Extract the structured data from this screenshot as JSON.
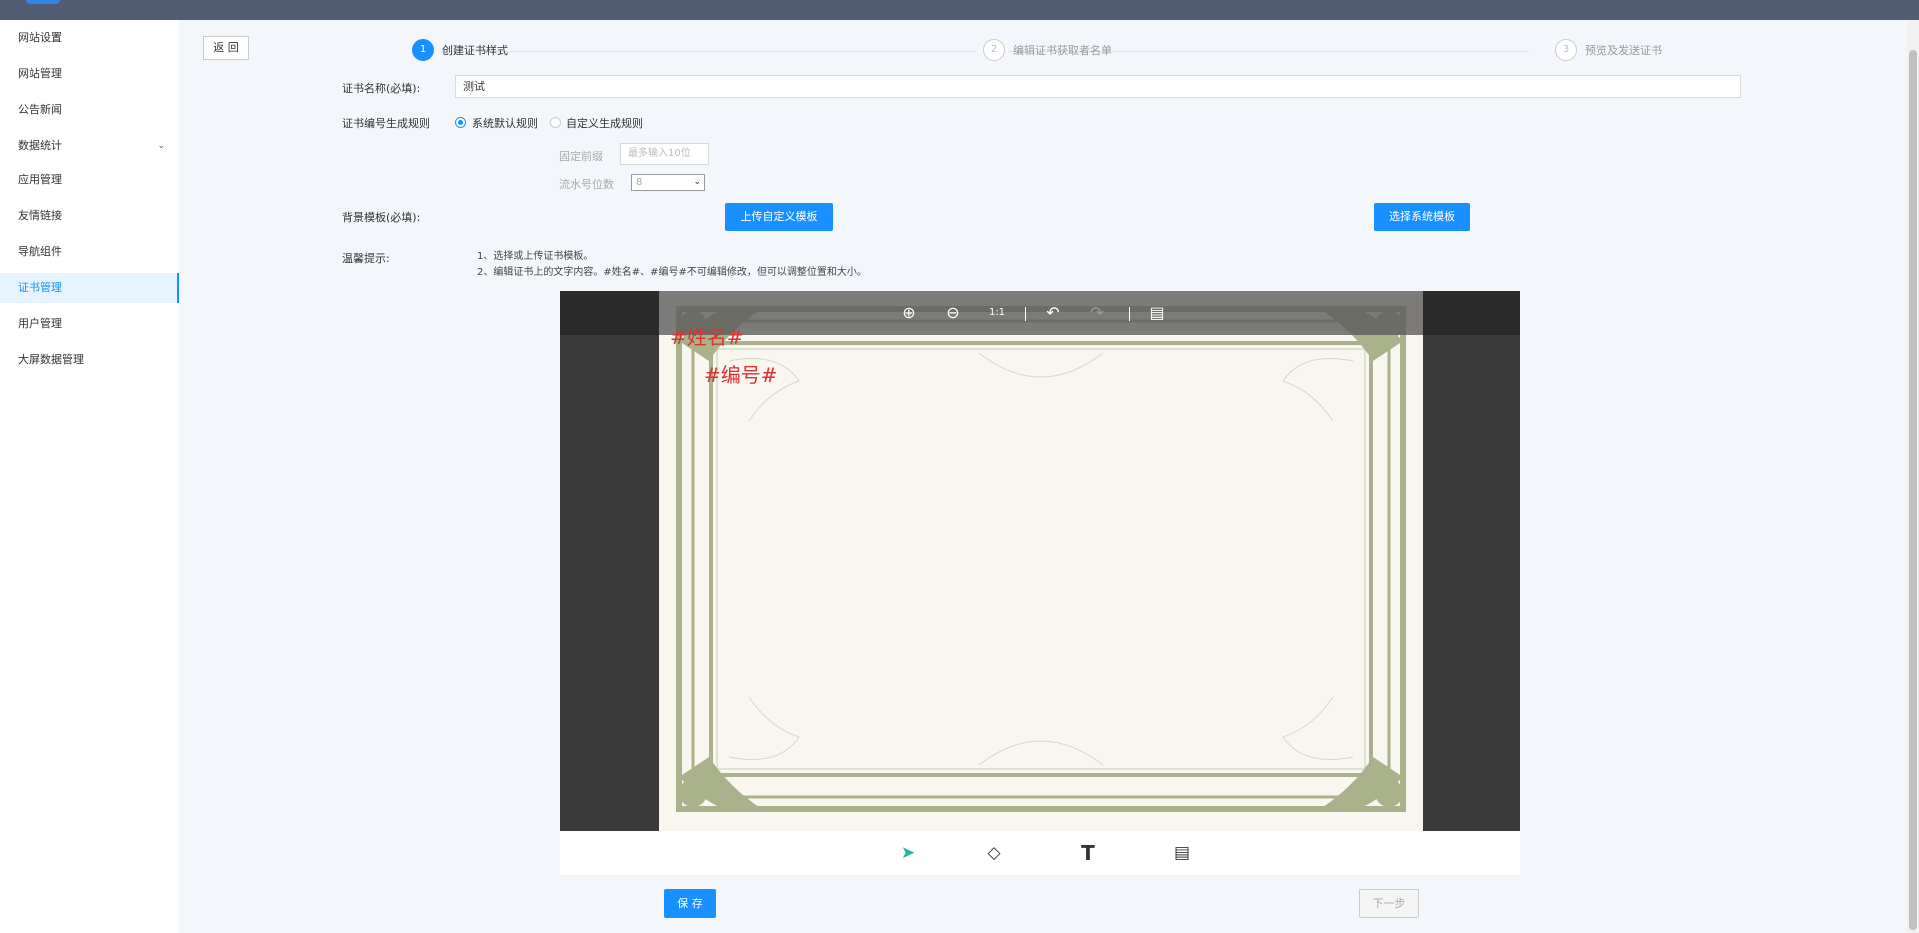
{
  "sidebar": {
    "items": [
      {
        "label": "网站设置"
      },
      {
        "label": "网站管理"
      },
      {
        "label": "公告新闻"
      },
      {
        "label": "数据统计"
      },
      {
        "label": "应用管理"
      },
      {
        "label": "友情链接"
      },
      {
        "label": "导航组件"
      },
      {
        "label": "证书管理"
      },
      {
        "label": "用户管理"
      },
      {
        "label": "大屏数据管理"
      }
    ],
    "active_item": "证书管理"
  },
  "header": {
    "back_label": "返 回"
  },
  "steps": [
    {
      "num": "1",
      "label": "创建证书样式",
      "active": true
    },
    {
      "num": "2",
      "label": "编辑证书获取者名单",
      "active": false
    },
    {
      "num": "3",
      "label": "预览及发送证书",
      "active": false
    }
  ],
  "form": {
    "name_label": "证书名称(必填):",
    "name_value": "测试",
    "rule_label": "证书编号生成规则",
    "rule_default": "系统默认规则",
    "rule_custom": "自定义生成规则",
    "prefix_label": "固定前缀",
    "prefix_placeholder": "最多输入10位",
    "digits_label": "流水号位数",
    "digits_value": "8",
    "bg_label": "背景模板(必填):",
    "upload_btn": "上传自定义模板",
    "select_btn": "选择系统模板",
    "tip_label": "温馨提示:",
    "tip_1": "1、选择或上传证书模板。",
    "tip_2": "2、编辑证书上的文字内容。#姓名#、#编号#不可编辑修改，但可以调整位置和大小。"
  },
  "certificate": {
    "name_field": "#姓名#",
    "number_field": "#编号#"
  },
  "footer": {
    "save_label": "保 存",
    "next_label": "下一步"
  },
  "colors": {
    "accent": "#1890ff",
    "topbar": "#525c73",
    "cert_text": "#d93333",
    "frame_green": "#a9b28a"
  }
}
